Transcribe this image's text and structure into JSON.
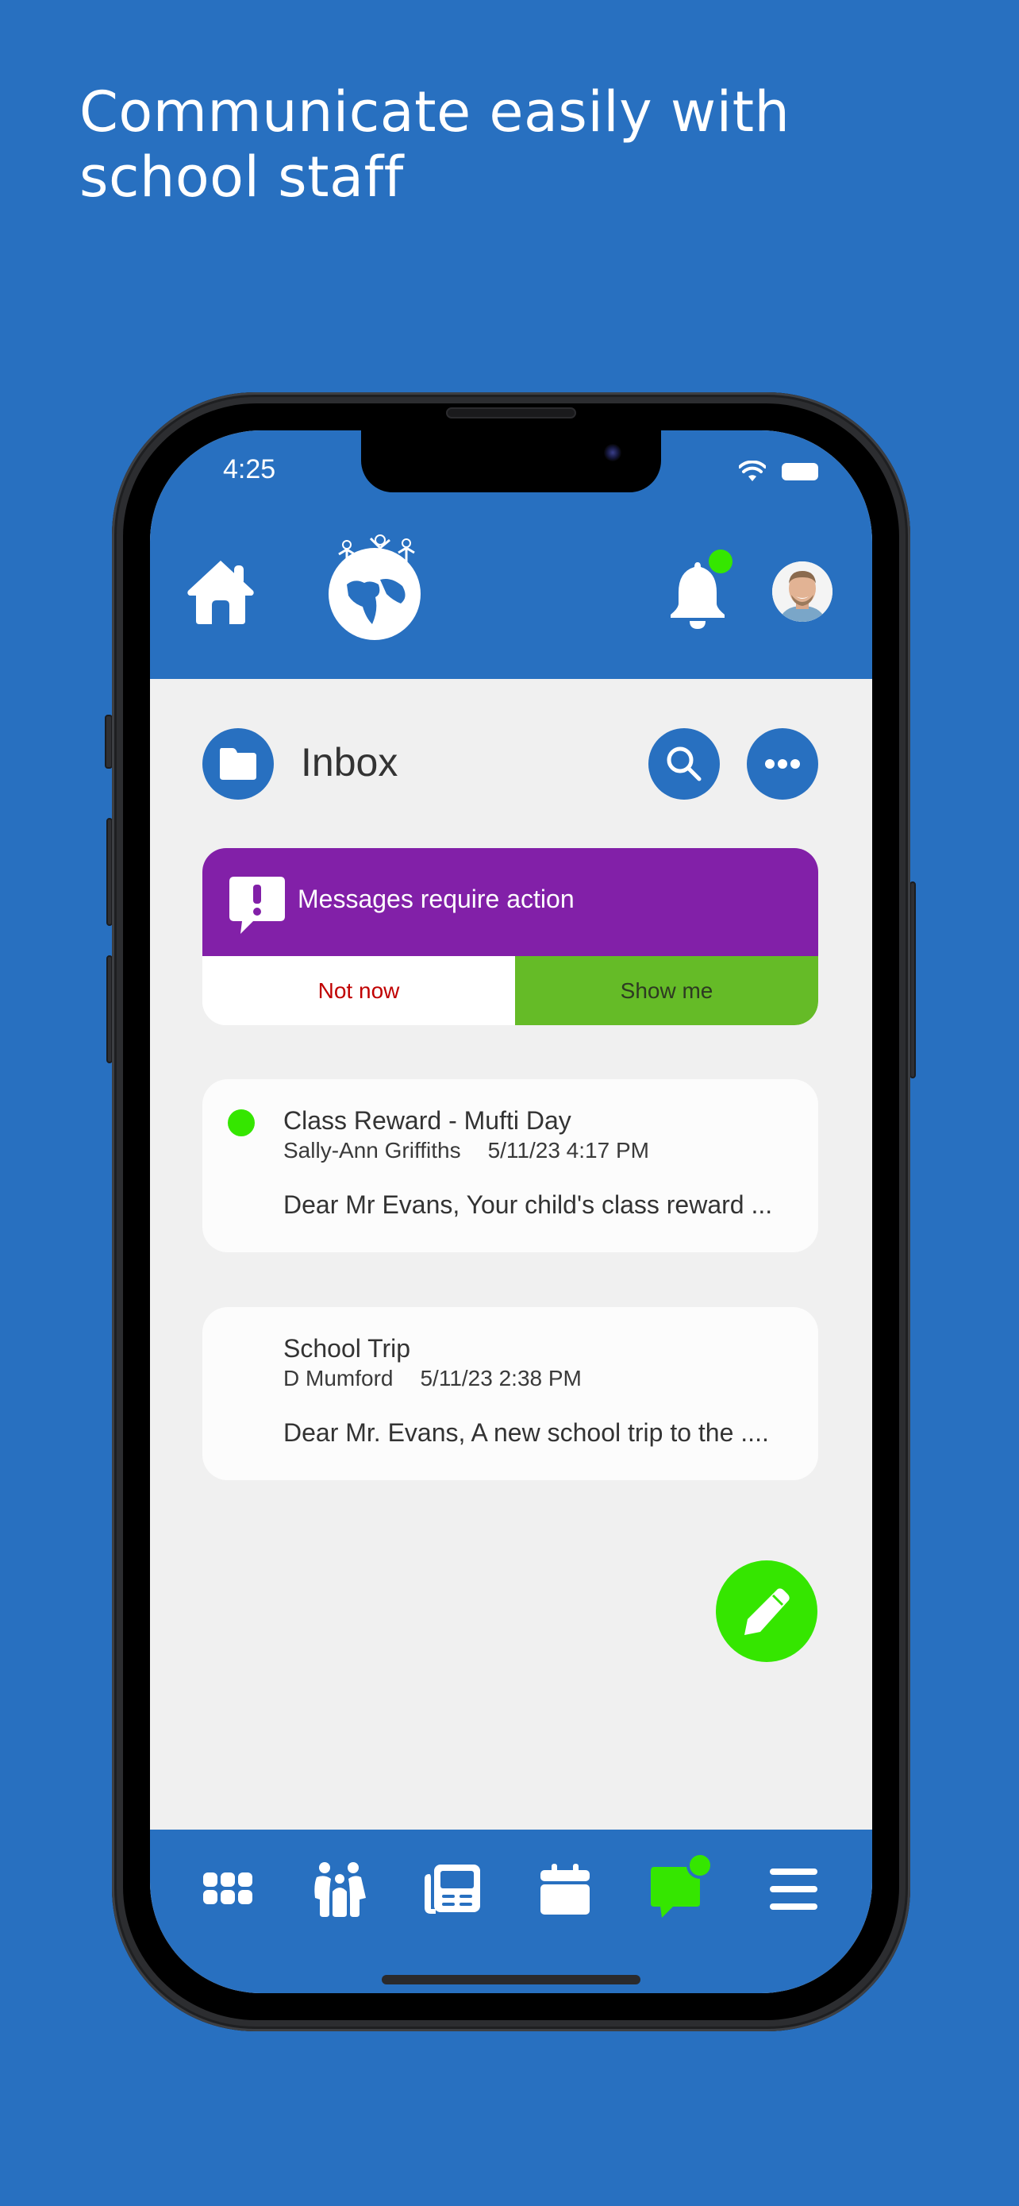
{
  "promo": {
    "headline": "Communicate easily with school staff"
  },
  "status_bar": {
    "time": "4:25",
    "icons": [
      "wifi-icon",
      "battery-icon"
    ]
  },
  "header": {
    "home_icon": "home-icon",
    "logo": "globe-with-children-logo",
    "notifications": {
      "icon": "bell-icon",
      "has_badge": true
    },
    "avatar": {
      "icon": "user-avatar"
    }
  },
  "inbox": {
    "title": "Inbox",
    "folder_icon": "folder-icon",
    "search_icon": "search-icon",
    "more_icon": "ellipsis-icon"
  },
  "alert": {
    "icon": "message-alert-icon",
    "text": "Messages require action",
    "dismiss_label": "Not now",
    "confirm_label": "Show me"
  },
  "messages": [
    {
      "subject": "Class Reward - Mufti Day",
      "sender": "Sally-Ann Griffiths",
      "date": "5/11/23 4:17 PM",
      "preview": "Dear Mr Evans, Your child's class reward ...",
      "unread": true
    },
    {
      "subject": "School Trip",
      "sender": "D Mumford",
      "date": "5/11/23 2:38 PM",
      "preview": "Dear Mr. Evans, A new school trip to the ....",
      "unread": false
    }
  ],
  "compose": {
    "icon": "pencil-icon"
  },
  "bottom_nav": [
    {
      "icon": "grid-icon",
      "active": false
    },
    {
      "icon": "family-icon",
      "active": false
    },
    {
      "icon": "newspaper-icon",
      "active": false
    },
    {
      "icon": "calendar-icon",
      "active": false
    },
    {
      "icon": "chat-icon",
      "active": true,
      "badge": true
    },
    {
      "icon": "menu-icon",
      "active": false
    }
  ],
  "colors": {
    "brand_blue": "#2870c0",
    "alert_purple": "#8220a8",
    "action_green": "#65bb27",
    "badge_green": "#35e600",
    "dismiss_red": "#c00000",
    "content_bg": "#f0f0f0"
  }
}
